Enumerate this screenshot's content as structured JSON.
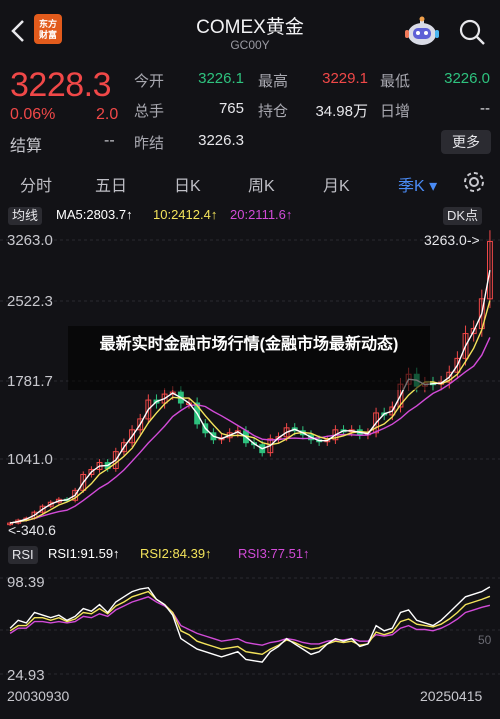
{
  "header": {
    "back_icon": "chevron-left-icon",
    "logo_text": "东方\n财富",
    "title": "COMEX黄金",
    "subtitle": "GC00Y",
    "assistant_icon": "robot-icon",
    "search_icon": "search-icon"
  },
  "quote": {
    "price": "3228.3",
    "change_pct": "0.06%",
    "change": "2.0",
    "settle_label": "结算",
    "settle_value": "--",
    "fields": [
      {
        "label": "今开",
        "value": "3226.1",
        "color": "#2ec27e"
      },
      {
        "label": "最高",
        "value": "3229.1",
        "color": "#f04848"
      },
      {
        "label": "最低",
        "value": "3226.0",
        "color": "#2ec27e"
      },
      {
        "label": "总手",
        "value": "765",
        "color": "#e6e6ea"
      },
      {
        "label": "持仓",
        "value": "34.98万",
        "color": "#e6e6ea"
      },
      {
        "label": "日增",
        "value": "--",
        "color": "#e6e6ea"
      },
      {
        "label": "昨结",
        "value": "3226.3",
        "color": "#e6e6ea"
      }
    ],
    "more_label": "更多"
  },
  "tabs": [
    {
      "label": "分时"
    },
    {
      "label": "五日"
    },
    {
      "label": "日K"
    },
    {
      "label": "周K"
    },
    {
      "label": "月K"
    },
    {
      "label": "季K ▾",
      "active": true
    }
  ],
  "settings_icon": "gear-icon",
  "main_chart": {
    "style_badge": "均线",
    "ma5": "MA5:2803.7↑",
    "ma10": "10:2412.4↑",
    "ma20": "20:2111.6↑",
    "dk_badge": "DK点",
    "y_ticks": [
      "3263.0",
      "2522.3",
      "1781.7",
      "1041.0"
    ],
    "high_marker": "3263.0->",
    "low_marker": "<-340.6"
  },
  "overlay_text": "最新实时金融市场行情(金融市场最新动态)",
  "rsi": {
    "badge": "RSI",
    "rsi1": "RSI1:91.59↑",
    "rsi2": "RSI2:84.39↑",
    "rsi3": "RSI3:77.51↑",
    "y_top": "98.39",
    "y_bottom": "24.93",
    "mid_label": "50"
  },
  "x_ticks": {
    "start": "20030930",
    "end": "20250415"
  },
  "colors": {
    "up": "#f04848",
    "down": "#2ec27e",
    "accent": "#4a8bf5",
    "ma5": "#ffffff",
    "ma10": "#f3e35b",
    "ma20": "#d24bd8"
  },
  "chart_data": {
    "type": "candlestick",
    "period": "quarterly",
    "ylim": [
      340.6,
      3263.0
    ],
    "close": [
      390,
      420,
      440,
      500,
      560,
      600,
      630,
      620,
      720,
      880,
      930,
      1000,
      940,
      1110,
      1200,
      1330,
      1440,
      1630,
      1600,
      1690,
      1710,
      1600,
      1600,
      1390,
      1300,
      1230,
      1250,
      1300,
      1320,
      1200,
      1180,
      1100,
      1240,
      1260,
      1350,
      1320,
      1280,
      1230,
      1210,
      1230,
      1330,
      1310,
      1330,
      1280,
      1300,
      1500,
      1480,
      1560,
      1790,
      1890,
      1770,
      1800,
      1790,
      1810,
      1910,
      2050,
      2300,
      2350,
      2650,
      3228.3
    ],
    "rsi1": [
      60,
      66,
      64,
      72,
      70,
      68,
      70,
      66,
      69,
      75,
      73,
      78,
      72,
      80,
      84,
      88,
      90,
      91,
      82,
      78,
      70,
      52,
      48,
      44,
      42,
      40,
      38,
      40,
      42,
      36,
      35,
      34,
      42,
      46,
      52,
      48,
      44,
      40,
      42,
      48,
      52,
      50,
      52,
      46,
      48,
      62,
      58,
      60,
      72,
      74,
      66,
      64,
      62,
      66,
      72,
      78,
      84,
      86,
      88,
      91.59
    ],
    "rsi2": [
      58,
      62,
      62,
      68,
      68,
      66,
      68,
      65,
      67,
      72,
      71,
      75,
      71,
      77,
      80,
      84,
      86,
      88,
      82,
      78,
      72,
      58,
      55,
      50,
      48,
      46,
      44,
      45,
      46,
      42,
      41,
      40,
      44,
      47,
      51,
      49,
      46,
      44,
      45,
      48,
      50,
      49,
      50,
      47,
      48,
      57,
      55,
      57,
      65,
      67,
      63,
      62,
      61,
      63,
      67,
      72,
      78,
      80,
      82,
      84.39
    ],
    "rsi3": [
      56,
      60,
      60,
      65,
      65,
      64,
      65,
      64,
      65,
      69,
      68,
      71,
      69,
      74,
      77,
      80,
      82,
      84,
      80,
      77,
      72,
      62,
      59,
      56,
      54,
      52,
      50,
      51,
      52,
      49,
      48,
      47,
      49,
      50,
      52,
      51,
      49,
      48,
      48,
      50,
      51,
      51,
      52,
      50,
      50,
      55,
      54,
      55,
      60,
      62,
      59,
      59,
      58,
      60,
      63,
      67,
      72,
      74,
      76,
      77.51
    ]
  }
}
